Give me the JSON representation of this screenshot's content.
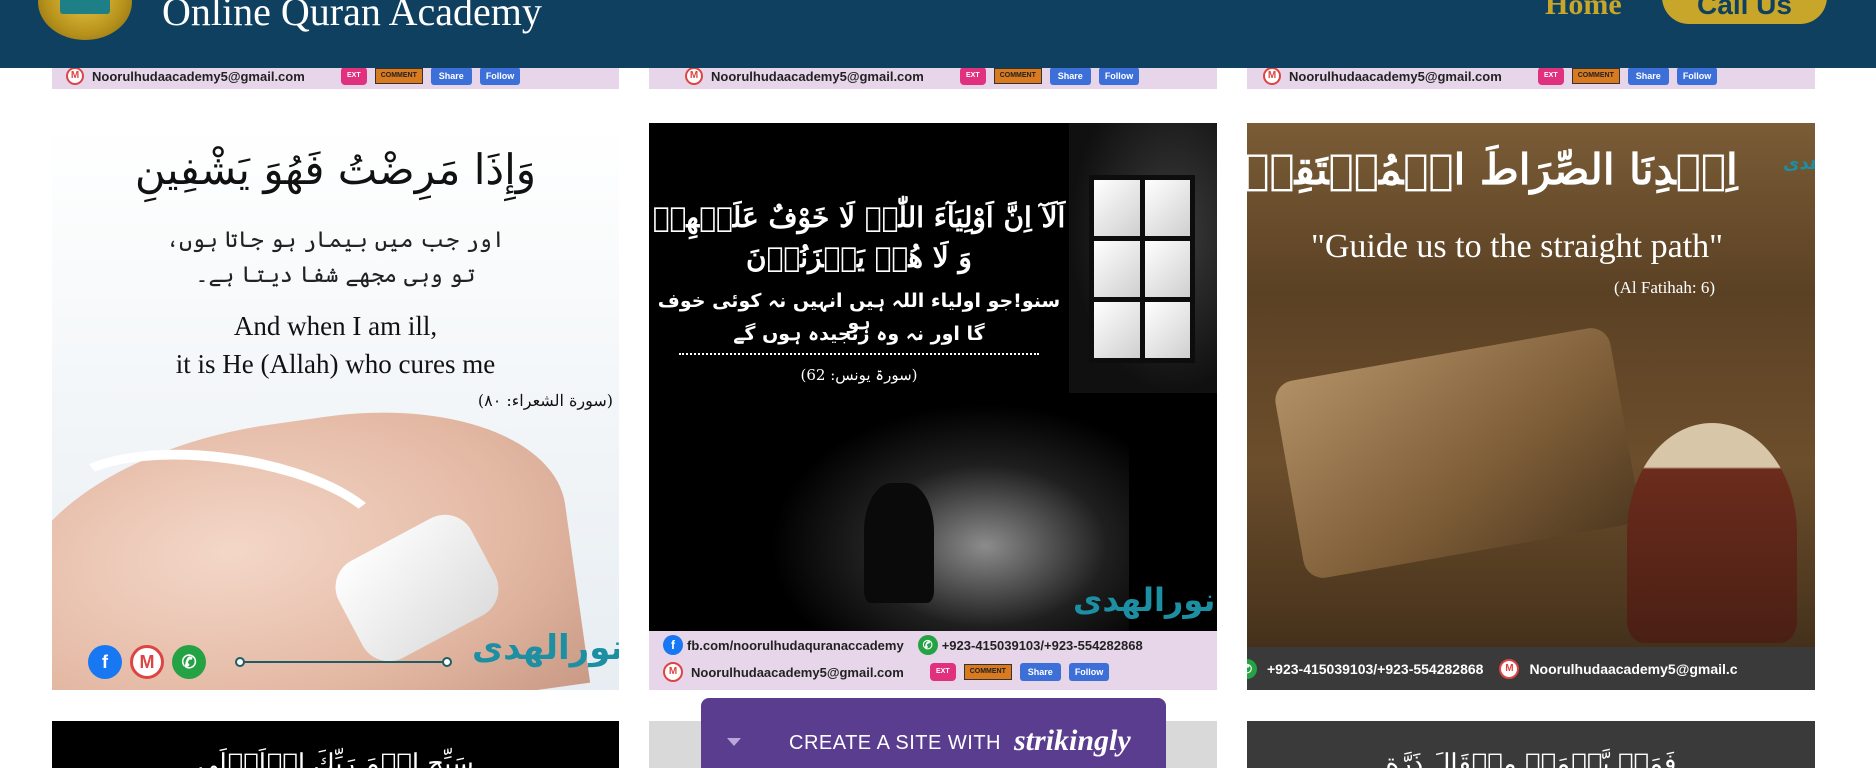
{
  "header": {
    "site_title": "Online Quran Academy",
    "nav_home": "Home",
    "call_button": "Call Us"
  },
  "top_strips": {
    "email": "Noorulhudaacademy5@gmail.com",
    "ext_badge": "EXT",
    "comment_badge": "COMMENT",
    "share": "Share",
    "follow": "Follow"
  },
  "card1": {
    "arabic": "وَإِذَا مَرِضْتُ فَهُوَ يَشْفِينِ",
    "urdu_line1": "اور جب میں بیمار ہو جاتا ہوں،",
    "urdu_line2": "تو وہی مجھے شفا دیتا ہے۔",
    "english_line1": "And when I am ill,",
    "english_line2": "it is He (Allah) who cures me",
    "reference": "(سورة الشعراء: ۸۰)",
    "brand": "نورالھدی"
  },
  "card2": {
    "arabic_line1": "اَلَآ اِنَّ اَوْلِيَآءَ اللّٰہِ لَا خَوْفٌ عَلَيۡهِمۡ",
    "arabic_line2": "وَ لَا هُمۡ يَحۡزَنُوۡنَ",
    "urdu_line1": "سنو!جو اولیاء اللہ ہیں انہیں نہ کوئی خوف ہو",
    "urdu_line2": "گا اور نہ وہ رنجیدہ ہوں گے",
    "reference": "(سورۃ یونس: 62)",
    "brand": "نورالھدی",
    "facebook": "fb.com/noorulhudaquranaccademy",
    "phones": "+923-415039103/+923-554282868",
    "email": "Noorulhudaacademy5@gmail.com",
    "share": "Share",
    "follow": "Follow"
  },
  "card3": {
    "arabic": "اِهۡدِنَا الصِّرَاطَ الۡمُسۡتَقِيۡمَ",
    "english": "\"Guide us to the straight path\"",
    "reference": "(Al Fatihah: 6)",
    "brand": "ھدی",
    "phones": "+923-415039103/+923-554282868",
    "email": "Noorulhudaacademy5@gmail.c"
  },
  "bottom_row": {
    "b1_text": "سَبِّحِ اسۡمَ رَبِّكَ الۡاَعۡلَى",
    "b3_text": "فَمَنۡ يَّعۡمَلۡ مِثۡقَالَ ذَرَّةٍ"
  },
  "strikingly_banner": {
    "label": "CREATE A SITE WITH",
    "brand": "strikingly"
  },
  "colors": {
    "header_bg": "#0f4060",
    "gold": "#c8a62a",
    "strip_bg": "#e7d6ea",
    "banner_bg": "#5a3d8f"
  }
}
